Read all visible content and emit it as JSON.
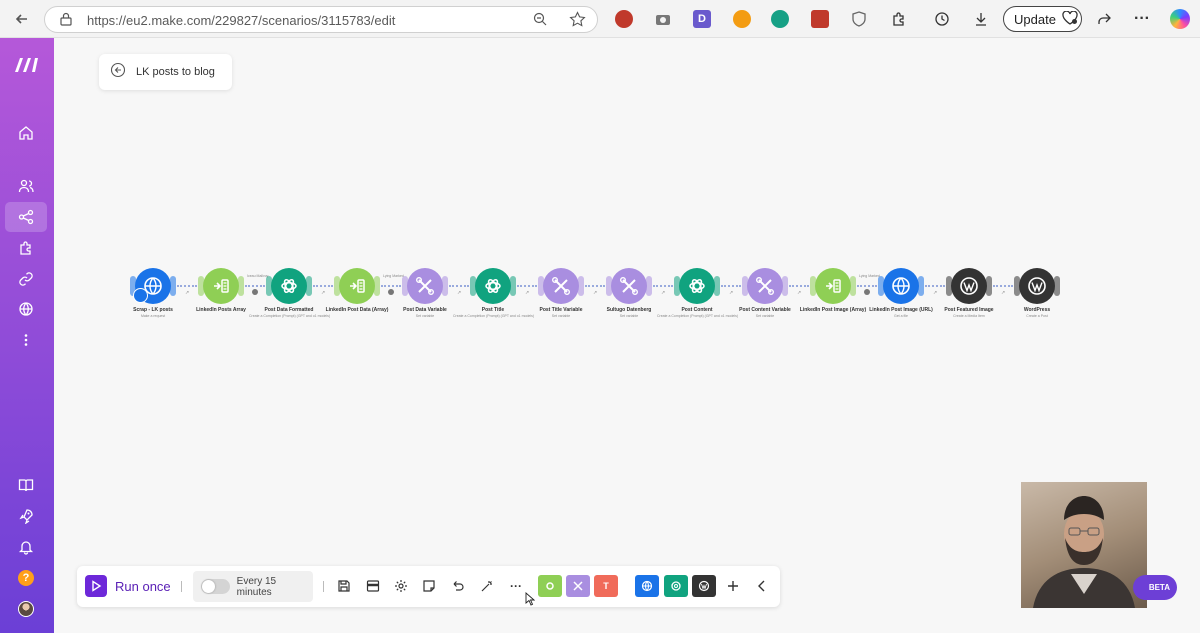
{
  "browser": {
    "url": "https://eu2.make.com/229827/scenarios/3115783/edit",
    "update_label": "Update"
  },
  "scenario": {
    "title": "LK posts to blog"
  },
  "colors": {
    "http": "#1a73e8",
    "iterator": "#8fcf55",
    "openai": "#10a37f",
    "tools": "#a98ee0",
    "wordpress": "#333333",
    "run_once": "#6d28d9"
  },
  "modules": [
    {
      "name": "Scrap - LK posts",
      "sub": "Make a request",
      "icon": "globe-icon",
      "kind": "http"
    },
    {
      "name": "LinkedIn Posts Array",
      "sub": "",
      "icon": "iterator-icon",
      "kind": "iterator"
    },
    {
      "name": "Post Data Formatted",
      "sub": "Create a Completion (Prompt) (GPT and o1 models)",
      "icon": "openai-icon",
      "kind": "openai"
    },
    {
      "name": "LinkedIn Post Data (Array)",
      "sub": "",
      "icon": "iterator-icon",
      "kind": "iterator"
    },
    {
      "name": "Post Data Variable",
      "sub": "Set variable",
      "icon": "tools-icon",
      "kind": "tools"
    },
    {
      "name": "Post Title",
      "sub": "Create a Completion (Prompt) (GPT and o1 models)",
      "icon": "openai-icon",
      "kind": "openai"
    },
    {
      "name": "Post Title Variable",
      "sub": "Set variable",
      "icon": "tools-icon",
      "kind": "tools"
    },
    {
      "name": "Sultugo Datenberg",
      "sub": "Set variable",
      "icon": "tools-icon",
      "kind": "tools"
    },
    {
      "name": "Post Content",
      "sub": "Create a Completion (Prompt) (GPT and o1 models)",
      "icon": "openai-icon",
      "kind": "openai"
    },
    {
      "name": "Post Content Variable",
      "sub": "Set variable",
      "icon": "tools-icon",
      "kind": "tools"
    },
    {
      "name": "LinkedIn Post Image (Array)",
      "sub": "",
      "icon": "iterator-icon",
      "kind": "iterator"
    },
    {
      "name": "LinkedIn Post Image (URL)",
      "sub": "Get a file",
      "icon": "globe-icon",
      "kind": "http"
    },
    {
      "name": "Post Featured Image",
      "sub": "Create a Media Item",
      "icon": "wordpress-icon",
      "kind": "wordpress"
    },
    {
      "name": "WordPress",
      "sub": "Create a Post",
      "icon": "wordpress-icon",
      "kind": "wordpress"
    }
  ],
  "connector_tags": [
    "",
    "Iceau Mallvuy",
    "",
    "Lying Marked",
    "",
    "",
    "",
    "",
    "",
    "",
    "Lying Marked",
    "",
    ""
  ],
  "toolbar": {
    "run_label": "Run once",
    "schedule_label": "Every 15 minutes"
  },
  "beta_label": "BETA"
}
